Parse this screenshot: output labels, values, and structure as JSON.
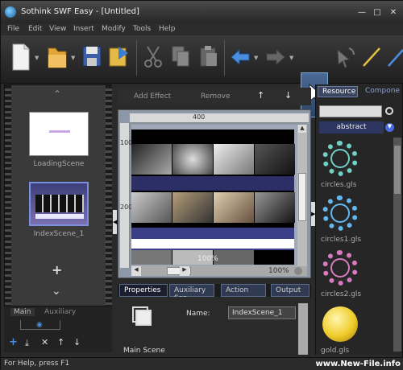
{
  "window": {
    "title": "Sothink SWF Easy - [Untitled]"
  },
  "menu": [
    "File",
    "Edit",
    "View",
    "Insert",
    "Modify",
    "Tools",
    "Help"
  ],
  "toolbar": {
    "items": [
      "new-file",
      "open-folder",
      "save",
      "export",
      "cut",
      "copy",
      "paste",
      "undo",
      "redo",
      "select",
      "transform",
      "line"
    ]
  },
  "scenes": [
    {
      "label": "LoadingScene"
    },
    {
      "label": "IndexScene_1"
    }
  ],
  "left_tabs": {
    "main": "Main",
    "auxiliary": "Auxiliary"
  },
  "effect_bar": {
    "add": "Add Effect",
    "remove": "Remove"
  },
  "ruler": {
    "top_400": "400",
    "left_100": "100",
    "left_200": "200"
  },
  "stage": {
    "zoom": "100%",
    "zoom_overlay": "100%"
  },
  "bottom_tabs": [
    "Properties",
    "Auxiliary Sce",
    "Action",
    "Output"
  ],
  "properties": {
    "scene_label": "Main Scene",
    "name_label": "Name:",
    "name_value": "IndexScene_1"
  },
  "resource": {
    "tabs": [
      "Resource",
      "Compone"
    ],
    "category": "abstract",
    "items": [
      {
        "label": "circles.gls",
        "color": "#6fd1c6"
      },
      {
        "label": "circles1.gls",
        "color": "#63b8f0"
      },
      {
        "label": "circles2.gls",
        "color": "#d97bc2"
      },
      {
        "label": "gold.gls",
        "color": "#f0cc2a"
      }
    ]
  },
  "status": {
    "text": "For Help, press F1",
    "watermark": "www.New-File.info"
  }
}
